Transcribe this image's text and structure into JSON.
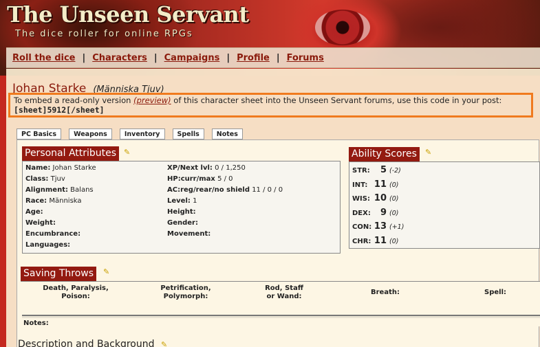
{
  "site": {
    "title": "The Unseen Servant",
    "subtitle": "The dice roller for online RPGs"
  },
  "nav": {
    "items": [
      "Roll the dice",
      "Characters",
      "Campaigns",
      "Profile",
      "Forums"
    ],
    "separator": "|"
  },
  "character": {
    "name": "Johan Starke",
    "race_class": "(Människa Tjuv)"
  },
  "embed": {
    "text_before": "To embed a read-only version ",
    "preview_link": "(preview)",
    "text_after": " of this character sheet into the Unseen Servant forums, use this code in your post:",
    "code": "[sheet]5912[/sheet]"
  },
  "tabs": [
    "PC Basics",
    "Weapons",
    "Inventory",
    "Spells",
    "Notes"
  ],
  "personal": {
    "header": "Personal Attributes",
    "left": [
      {
        "label": "Name:",
        "value": "Johan Starke"
      },
      {
        "label": "Class:",
        "value": "Tjuv"
      },
      {
        "label": "Alignment:",
        "value": "Balans"
      },
      {
        "label": "Race:",
        "value": "Människa"
      },
      {
        "label": "Age:",
        "value": ""
      },
      {
        "label": "Weight:",
        "value": ""
      },
      {
        "label": "Encumbrance:",
        "value": ""
      },
      {
        "label": "Languages:",
        "value": ""
      }
    ],
    "right": [
      {
        "label": "XP/Next lvl:",
        "value": "0 / 1,250"
      },
      {
        "label": "HP:curr/max",
        "value": "5 / 0"
      },
      {
        "label": "AC:reg/rear/no shield",
        "value": "11 / 0 / 0"
      },
      {
        "label": "Level:",
        "value": "1"
      },
      {
        "label": "Height:",
        "value": ""
      },
      {
        "label": "Gender:",
        "value": ""
      },
      {
        "label": "Movement:",
        "value": ""
      }
    ]
  },
  "abilities": {
    "header": "Ability Scores",
    "rows": [
      {
        "label": "STR:",
        "value": "5",
        "mod": "(-2)"
      },
      {
        "label": "INT:",
        "value": "11",
        "mod": "(0)"
      },
      {
        "label": "WIS:",
        "value": "10",
        "mod": "(0)"
      },
      {
        "label": "DEX:",
        "value": "9",
        "mod": "(0)"
      },
      {
        "label": "CON:",
        "value": "13",
        "mod": "(+1)"
      },
      {
        "label": "CHR:",
        "value": "11",
        "mod": "(0)"
      }
    ]
  },
  "saving": {
    "header": "Saving Throws",
    "cols": [
      {
        "line1": "Death, Paralysis,",
        "line2": "Poison:"
      },
      {
        "line1": "Petrification,",
        "line2": "Polymorph:"
      },
      {
        "line1": "Rod, Staff",
        "line2": "or Wand:"
      },
      {
        "line1": "Breath:",
        "line2": ""
      },
      {
        "line1": "Spell:",
        "line2": ""
      }
    ],
    "notes_label": "Notes:"
  },
  "description": {
    "header": "Description and Background"
  },
  "colors": {
    "accent": "#931a10",
    "link": "#8a1a0c",
    "highlight_border": "#f07a1e"
  }
}
